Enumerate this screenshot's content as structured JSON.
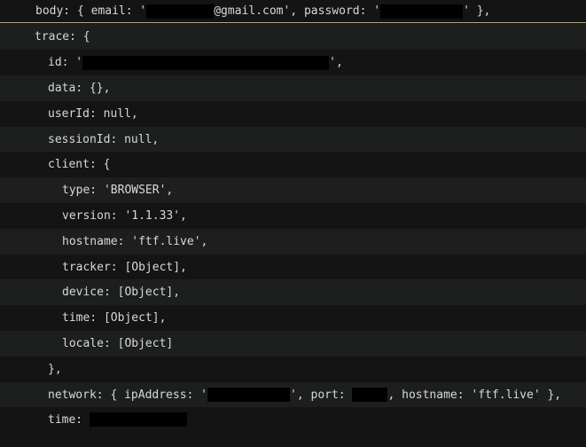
{
  "log": {
    "lines": [
      {
        "pre": "body: { email: '",
        "mid": "@gmail.com', password: '",
        "post": "' },"
      },
      {
        "text": "trace: {"
      },
      {
        "pre": "id: '",
        "post": "',"
      },
      {
        "text": "data: {},"
      },
      {
        "text": "userId: null,"
      },
      {
        "text": "sessionId: null,"
      },
      {
        "text": "client: {"
      },
      {
        "text": "type: 'BROWSER',"
      },
      {
        "text": "version: '1.1.33',"
      },
      {
        "text": "hostname: 'ftf.live',"
      },
      {
        "text": "tracker: [Object],"
      },
      {
        "text": "device: [Object],"
      },
      {
        "text": "time: [Object],"
      },
      {
        "text": "locale: [Object]"
      },
      {
        "text": "},"
      },
      {
        "pre": "network: { ipAddress: '",
        "mid": "', port: ",
        "post": ", hostname: 'ftf.live' },"
      },
      {
        "pre": "time: "
      }
    ]
  },
  "colors": {
    "background_dark": "#141414",
    "background_light": "#1d1e1e",
    "text": "#d8d8d8",
    "divider": "#b8a878",
    "redaction": "#000000"
  }
}
